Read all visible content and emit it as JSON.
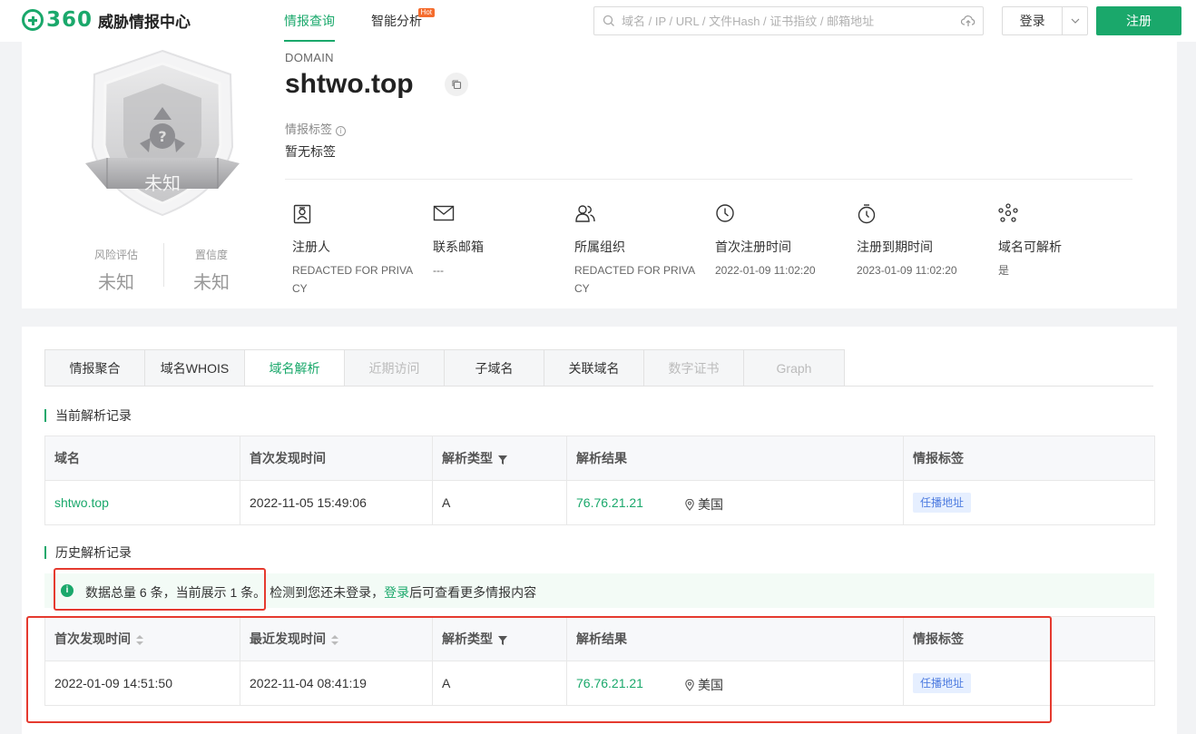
{
  "header": {
    "logo_num": "360",
    "logo_text": "威胁情报中心",
    "nav": [
      {
        "label": "情报查询"
      },
      {
        "label": "智能分析",
        "badge": "Hot"
      }
    ],
    "search_placeholder": "域名 / IP / URL / 文件Hash / 证书指纹 / 邮箱地址",
    "login_label": "登录",
    "register_label": "注册"
  },
  "profile": {
    "badge_text": "未知",
    "risk_label": "风险评估",
    "risk_value": "未知",
    "confidence_label": "置信度",
    "confidence_value": "未知",
    "type": "DOMAIN",
    "domain": "shtwo.top",
    "tag_title": "情报标签",
    "tag_value": "暂无标签",
    "meta": [
      {
        "icon": "registrant-icon",
        "label": "注册人",
        "value": "REDACTED FOR PRIVACY"
      },
      {
        "icon": "mail-icon",
        "label": "联系邮箱",
        "value": "---"
      },
      {
        "icon": "organization-icon",
        "label": "所属组织",
        "value": "REDACTED FOR PRIVACY"
      },
      {
        "icon": "clock-icon",
        "label": "首次注册时间",
        "value": "2022-01-09 11:02:20"
      },
      {
        "icon": "stopwatch-icon",
        "label": "注册到期时间",
        "value": "2023-01-09 11:02:20"
      },
      {
        "icon": "network-icon",
        "label": "域名可解析",
        "value": "是"
      }
    ]
  },
  "tabs": [
    {
      "label": "情报聚合",
      "state": "normal"
    },
    {
      "label": "域名WHOIS",
      "state": "normal"
    },
    {
      "label": "域名解析",
      "state": "active"
    },
    {
      "label": "近期访问",
      "state": "disabled"
    },
    {
      "label": "子域名",
      "state": "normal"
    },
    {
      "label": "关联域名",
      "state": "normal"
    },
    {
      "label": "数字证书",
      "state": "disabled"
    },
    {
      "label": "Graph",
      "state": "disabled"
    }
  ],
  "current": {
    "title": "当前解析记录",
    "headers": [
      "域名",
      "首次发现时间",
      "解析类型",
      "解析结果",
      "情报标签"
    ],
    "rows": [
      {
        "domain": "shtwo.top",
        "first_seen": "2022-11-05 15:49:06",
        "type": "A",
        "ip": "76.76.21.21",
        "geo": "美国",
        "tag": "任播地址"
      }
    ]
  },
  "history": {
    "title": "历史解析记录",
    "notice_count": "数据总量 6 条，当前展示 1 条。",
    "notice_pre": "检测到您还未登录，",
    "notice_link": "登录",
    "notice_post": "后可查看更多情报内容",
    "headers": [
      "首次发现时间",
      "最近发现时间",
      "解析类型",
      "解析结果",
      "情报标签"
    ],
    "rows": [
      {
        "first_seen": "2022-01-09 14:51:50",
        "last_seen": "2022-11-04 08:41:19",
        "type": "A",
        "ip": "76.76.21.21",
        "geo": "美国",
        "tag": "任播地址"
      }
    ]
  },
  "colors": {
    "accent": "#1aa86b",
    "highlight_box": "#e53a2f",
    "chip_bg": "#e6efff",
    "chip_text": "#4e7ce0"
  }
}
